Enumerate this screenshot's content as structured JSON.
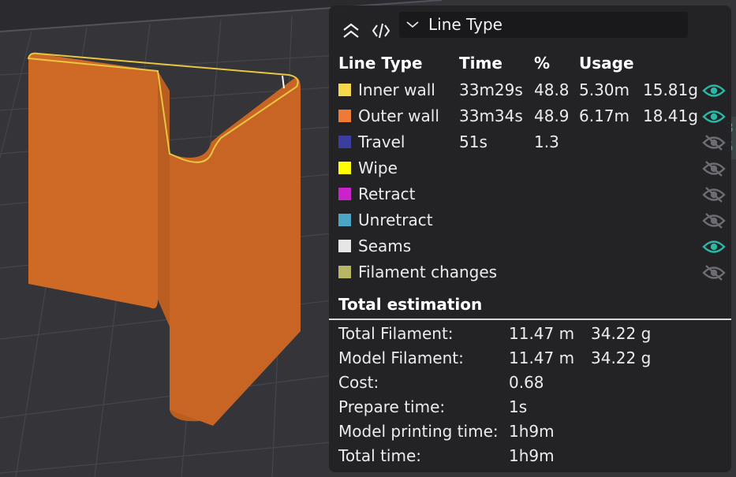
{
  "header": {
    "view_mode": "Line Type",
    "icons": {
      "collapse": "double-chevron-up-icon",
      "code": "code-brackets-icon",
      "dropdown": "chevron-down-icon"
    }
  },
  "columns": {
    "line_type": "Line Type",
    "time": "Time",
    "percent": "%",
    "usage": "Usage"
  },
  "line_types": [
    {
      "label": "Inner wall",
      "color": "#f5d84c",
      "time": "33m29s",
      "percent": "48.8",
      "length": "5.30m",
      "weight": "15.81g",
      "visible": true
    },
    {
      "label": "Outer wall",
      "color": "#ef7a38",
      "time": "33m34s",
      "percent": "48.9",
      "length": "6.17m",
      "weight": "18.41g",
      "visible": true
    },
    {
      "label": "Travel",
      "color": "#3a3ea0",
      "time": "51s",
      "percent": "1.3",
      "length": "",
      "weight": "",
      "visible": false
    },
    {
      "label": "Wipe",
      "color": "#ffff00",
      "time": "",
      "percent": "",
      "length": "",
      "weight": "",
      "visible": false
    },
    {
      "label": "Retract",
      "color": "#cc22cc",
      "time": "",
      "percent": "",
      "length": "",
      "weight": "",
      "visible": false
    },
    {
      "label": "Unretract",
      "color": "#4aa6c4",
      "time": "",
      "percent": "",
      "length": "",
      "weight": "",
      "visible": false
    },
    {
      "label": "Seams",
      "color": "#e6e6e6",
      "time": "",
      "percent": "",
      "length": "",
      "weight": "",
      "visible": true
    },
    {
      "label": "Filament changes",
      "color": "#b8b566",
      "time": "",
      "percent": "",
      "length": "",
      "weight": "",
      "visible": false
    }
  ],
  "total_estimation": {
    "title": "Total estimation",
    "rows": [
      {
        "key": "Total Filament:",
        "v1": "11.47 m",
        "v2": "34.22 g"
      },
      {
        "key": "Model Filament:",
        "v1": "11.47 m",
        "v2": "34.22 g"
      },
      {
        "key": "Cost:",
        "v1": "0.68",
        "v2": ""
      },
      {
        "key": "Prepare time:",
        "v1": "1s",
        "v2": ""
      },
      {
        "key": "Model printing time:",
        "v1": "1h9m",
        "v2": ""
      },
      {
        "key": "Total time:",
        "v1": "1h9m",
        "v2": ""
      }
    ]
  },
  "edge_indicator": {
    "line1": "3",
    "line2": "75"
  },
  "colors": {
    "accent": "#27b8a6",
    "eye_on": "#2ab7a5",
    "eye_off": "#6c6c72",
    "model": "#d26a26"
  }
}
